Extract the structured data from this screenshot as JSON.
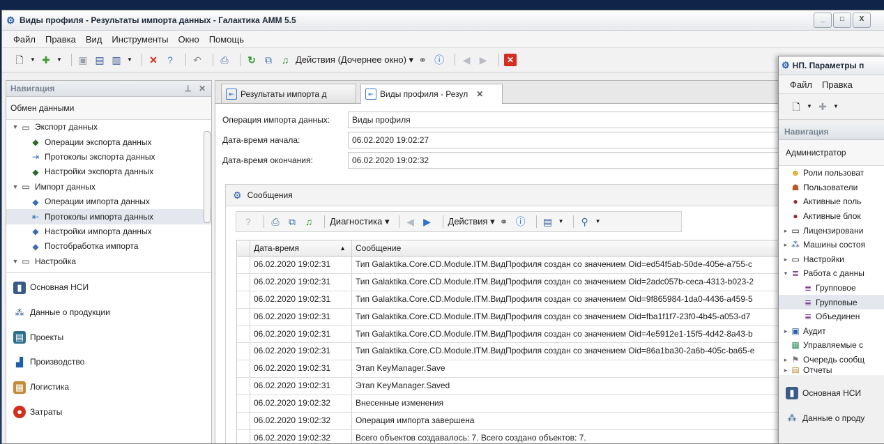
{
  "main_window": {
    "title": "Виды профиля - Результаты импорта данных - Галактика АММ 5.5",
    "controls": {
      "minimize": "_",
      "maximize": "□",
      "close": "X"
    }
  },
  "menu": [
    "Файл",
    "Правка",
    "Вид",
    "Инструменты",
    "Окно",
    "Помощь"
  ],
  "toolbar": {
    "actions_label": "Действия (Дочернее окно)"
  },
  "navigation": {
    "header": "Навигация",
    "group": "Обмен данными",
    "tree": [
      {
        "label": "Экспорт данных",
        "level": 0,
        "icon": "folder-icon",
        "expanded": true
      },
      {
        "label": "Операции экспорта данных",
        "level": 1,
        "icon": "operation-icon"
      },
      {
        "label": "Протоколы экспорта данных",
        "level": 1,
        "icon": "protocol-icon"
      },
      {
        "label": "Настройки экспорта данных",
        "level": 1,
        "icon": "settings-icon"
      },
      {
        "label": "Импорт данных",
        "level": 0,
        "icon": "folder-icon",
        "expanded": true
      },
      {
        "label": "Операции импорта данных",
        "level": 1,
        "icon": "operation-icon"
      },
      {
        "label": "Протоколы импорта данных",
        "level": 1,
        "icon": "protocol-icon",
        "selected": true
      },
      {
        "label": "Настройки импорта данных",
        "level": 1,
        "icon": "settings-icon"
      },
      {
        "label": "Постобработка импорта",
        "level": 1,
        "icon": "operation-icon"
      },
      {
        "label": "Настройка",
        "level": 0,
        "icon": "folder-icon",
        "expanded": true
      }
    ],
    "modules": [
      {
        "label": "Основная НСИ",
        "icon": "book-icon"
      },
      {
        "label": "Данные о продукции",
        "icon": "product-tree-icon"
      },
      {
        "label": "Проекты",
        "icon": "projects-icon"
      },
      {
        "label": "Производство",
        "icon": "production-icon"
      },
      {
        "label": "Логистика",
        "icon": "logistics-icon"
      },
      {
        "label": "Затраты",
        "icon": "costs-icon"
      }
    ]
  },
  "tabs": [
    {
      "label": "Результаты импорта д",
      "active": false
    },
    {
      "label": "Виды профиля - Резул",
      "active": true
    }
  ],
  "form": {
    "operation_label": "Операция импорта данных:",
    "operation_value": "Виды профиля",
    "start_label": "Дата-время начала:",
    "start_value": "06.02.2020 19:02:27",
    "end_label": "Дата-время окончания:",
    "end_value": "06.02.2020 19:02:32"
  },
  "messages": {
    "title": "Сообщения",
    "toolbar": {
      "diagnostics": "Диагностика",
      "actions": "Действия"
    },
    "columns": {
      "datetime": "Дата-время",
      "message": "Сообщение"
    },
    "rows": [
      {
        "datetime": "06.02.2020 19:02:31",
        "message": "Тип Galaktika.Core.CD.Module.ITM.ВидПрофиля создан со значением Oid=ed54f5ab-50de-405e-a755-c"
      },
      {
        "datetime": "06.02.2020 19:02:31",
        "message": "Тип Galaktika.Core.CD.Module.ITM.ВидПрофиля создан со значением Oid=2adc057b-ceca-4313-b023-2"
      },
      {
        "datetime": "06.02.2020 19:02:31",
        "message": "Тип Galaktika.Core.CD.Module.ITM.ВидПрофиля создан со значением Oid=9f865984-1da0-4436-a459-5"
      },
      {
        "datetime": "06.02.2020 19:02:31",
        "message": "Тип Galaktika.Core.CD.Module.ITM.ВидПрофиля создан со значением Oid=fba1f1f7-23f0-4b45-a053-d7"
      },
      {
        "datetime": "06.02.2020 19:02:31",
        "message": "Тип Galaktika.Core.CD.Module.ITM.ВидПрофиля создан со значением Oid=4e5912e1-15f5-4d42-8a43-b"
      },
      {
        "datetime": "06.02.2020 19:02:31",
        "message": "Тип Galaktika.Core.CD.Module.ITM.ВидПрофиля создан со значением Oid=86a1ba30-2a6b-405c-ba65-e"
      },
      {
        "datetime": "06.02.2020 19:02:31",
        "message": "Этап KeyManager.Save"
      },
      {
        "datetime": "06.02.2020 19:02:31",
        "message": "Этап KeyManager.Saved"
      },
      {
        "datetime": "06.02.2020 19:02:32",
        "message": "Внесенные изменения"
      },
      {
        "datetime": "06.02.2020 19:02:32",
        "message": "Операция импорта завершена"
      },
      {
        "datetime": "06.02.2020 19:02:32",
        "message": "Всего объектов создавалось: 7. Всего создано объектов: 7."
      }
    ]
  },
  "second_window": {
    "title": "НП. Параметры п",
    "menu": [
      "Файл",
      "Правка"
    ],
    "nav_header": "Навигация",
    "group": "Администратор",
    "tree": [
      {
        "label": "Роли пользоват",
        "level": 0,
        "icon": "roles-icon"
      },
      {
        "label": "Пользователи",
        "level": 0,
        "icon": "users-icon"
      },
      {
        "label": "Активные поль",
        "level": 0,
        "icon": "info-icon"
      },
      {
        "label": "Активные блок",
        "level": 0,
        "icon": "info-icon"
      },
      {
        "label": "Лицензировани",
        "level": 0,
        "icon": "folder-icon",
        "expandable": true
      },
      {
        "label": "Машины состоя",
        "level": 0,
        "icon": "state-machine-icon",
        "expandable": true
      },
      {
        "label": "Настройки",
        "level": 0,
        "icon": "folder-icon",
        "expandable": true
      },
      {
        "label": "Работа с данны",
        "level": 0,
        "icon": "database-icon",
        "expanded": true
      },
      {
        "label": "Групповое",
        "level": 1,
        "icon": "database-icon"
      },
      {
        "label": "Групповые",
        "level": 1,
        "icon": "database-icon"
      },
      {
        "label": "Объединен",
        "level": 1,
        "icon": "database-icon"
      },
      {
        "label": "Аудит",
        "level": 0,
        "icon": "audit-icon",
        "expandable": true
      },
      {
        "label": "Управляемые с",
        "level": 0,
        "icon": "managed-icon"
      },
      {
        "label": "Очередь сообщ",
        "level": 0,
        "icon": "queue-icon",
        "expandable": true
      },
      {
        "label": "Отчеты",
        "level": 0,
        "icon": "reports-icon",
        "expandable": true
      }
    ],
    "modules": [
      {
        "label": "Основная НСИ",
        "icon": "book-icon"
      },
      {
        "label": "Данные о проду",
        "icon": "product-tree-icon"
      }
    ]
  }
}
